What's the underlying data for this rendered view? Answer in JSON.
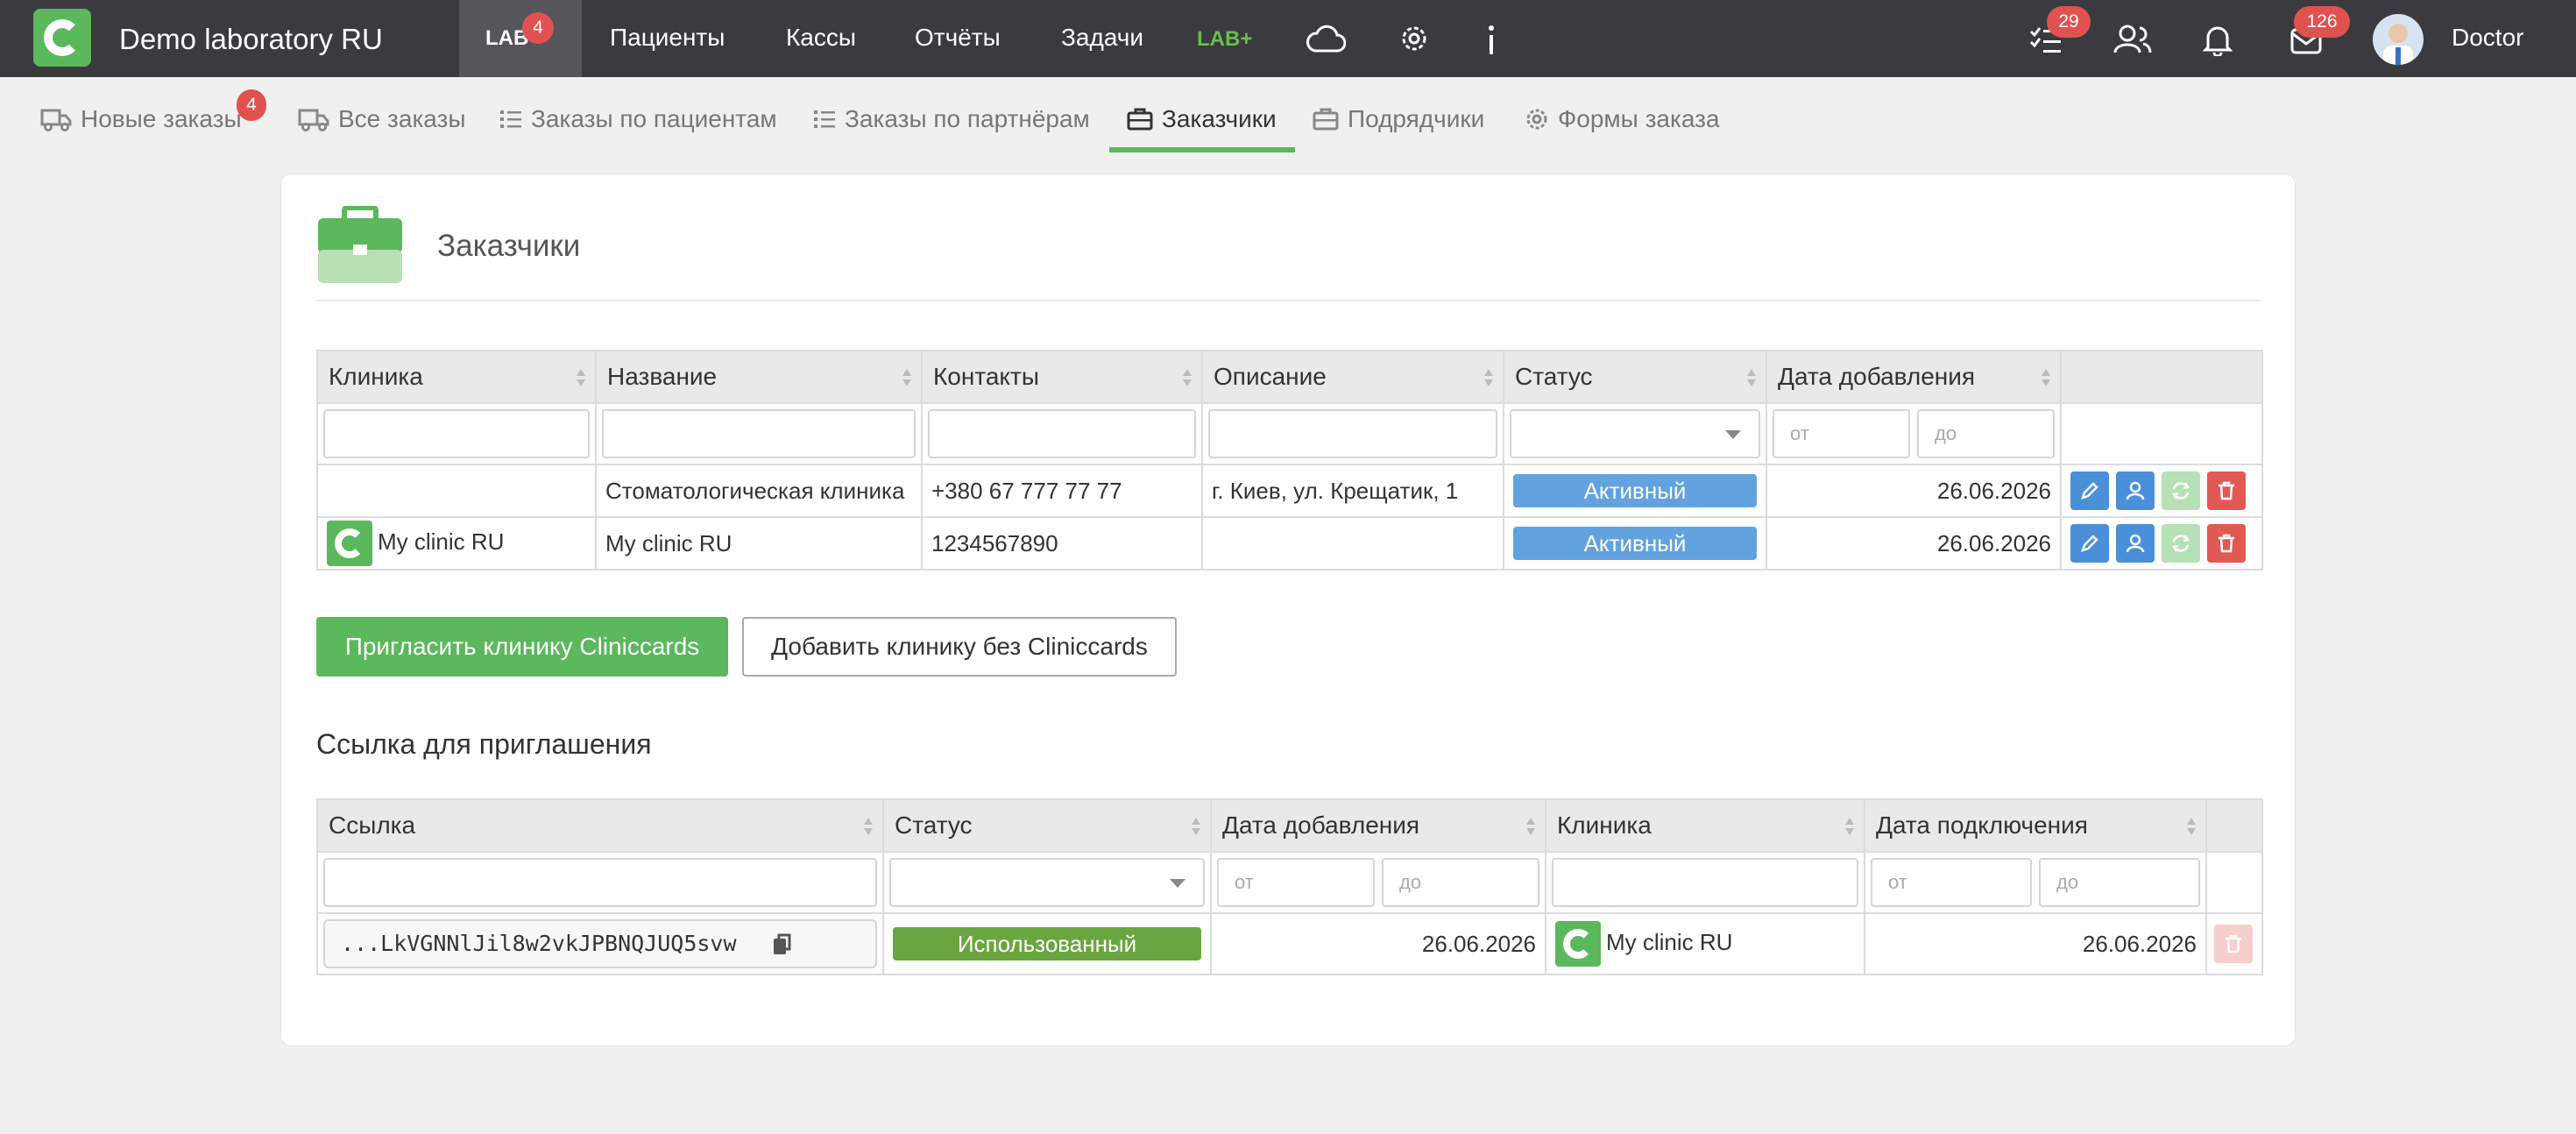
{
  "topbar": {
    "brand": "Demo laboratory RU",
    "lab_label": "LAB",
    "lab_badge": "4",
    "nav": [
      "Пациенты",
      "Кассы",
      "Отчёты",
      "Задачи"
    ],
    "labplus": "LAB+",
    "tasks_badge": "29",
    "messages_badge": "126",
    "user": "Doctor"
  },
  "subnav": {
    "items": [
      "Новые заказы",
      "Все заказы",
      "Заказы по пациентам",
      "Заказы по партнёрам",
      "Заказчики",
      "Подрядчики",
      "Формы заказа"
    ],
    "new_badge": "4",
    "active": "Заказчики"
  },
  "page": {
    "title": "Заказчики",
    "primary_button": "Пригласить клинику Cliniccards",
    "secondary_button": "Добавить клинику без Cliniccards",
    "invite_section_title": "Ссылка для приглашения"
  },
  "clients_table": {
    "headers": [
      "Клиника",
      "Название",
      "Контакты",
      "Описание",
      "Статус",
      "Дата добавления"
    ],
    "filter_from": "от",
    "filter_to": "до",
    "rows": [
      {
        "clinic": "",
        "name": "Стоматологическая клиника",
        "contacts": "+380 67 777 77 77",
        "description": "г. Киев, ул. Крещатик, 1",
        "status": "Активный",
        "date": "26.06.2026"
      },
      {
        "clinic": "My clinic RU",
        "name": "My clinic RU",
        "contacts": "1234567890",
        "description": "",
        "status": "Активный",
        "date": "26.06.2026"
      }
    ]
  },
  "invite_table": {
    "headers": [
      "Ссылка",
      "Статус",
      "Дата добавления",
      "Клиника",
      "Дата подключения"
    ],
    "filter_from": "от",
    "filter_to": "до",
    "rows": [
      {
        "link": "...LkVGNNlJil8w2vkJPBNQJUQ5svw",
        "status": "Использованный",
        "date_added": "26.06.2026",
        "clinic": "My clinic RU",
        "date_connected": "26.06.2026"
      }
    ]
  },
  "colors": {
    "topbar": "#3b3b3f",
    "accent_green": "#5cb85c",
    "status_blue": "#62a3df",
    "used_green": "#6aa63f",
    "badge_red": "#e0524f",
    "delete_red": "#e05a55"
  },
  "icons": [
    "truck-icon",
    "list-icon",
    "briefcase-icon",
    "gear-icon",
    "cloud-icon",
    "info-icon",
    "tasks-icon",
    "users-icon",
    "bell-icon",
    "envelope-icon",
    "pencil-icon",
    "user-icon",
    "refresh-icon",
    "trash-icon",
    "copy-icon"
  ]
}
